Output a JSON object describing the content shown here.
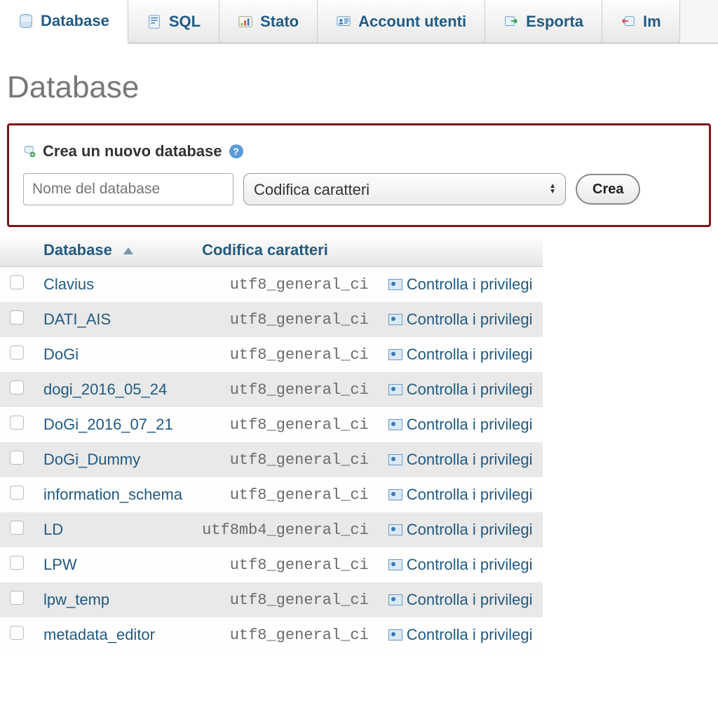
{
  "tabs": [
    {
      "label": "Database"
    },
    {
      "label": "SQL"
    },
    {
      "label": "Stato"
    },
    {
      "label": "Account utenti"
    },
    {
      "label": "Esporta"
    },
    {
      "label": "Im"
    }
  ],
  "page_title": "Database",
  "create": {
    "heading": "Crea un nuovo database",
    "name_placeholder": "Nome del database",
    "collation_placeholder": "Codifica caratteri",
    "button": "Crea"
  },
  "columns": {
    "database": "Database",
    "collation": "Codifica caratteri"
  },
  "priv_label": "Controlla i privilegi",
  "databases": [
    {
      "name": "Clavius",
      "collation": "utf8_general_ci"
    },
    {
      "name": "DATI_AIS",
      "collation": "utf8_general_ci"
    },
    {
      "name": "DoGi",
      "collation": "utf8_general_ci"
    },
    {
      "name": "dogi_2016_05_24",
      "collation": "utf8_general_ci"
    },
    {
      "name": "DoGi_2016_07_21",
      "collation": "utf8_general_ci"
    },
    {
      "name": "DoGi_Dummy",
      "collation": "utf8_general_ci"
    },
    {
      "name": "information_schema",
      "collation": "utf8_general_ci"
    },
    {
      "name": "LD",
      "collation": "utf8mb4_general_ci"
    },
    {
      "name": "LPW",
      "collation": "utf8_general_ci"
    },
    {
      "name": "lpw_temp",
      "collation": "utf8_general_ci"
    },
    {
      "name": "metadata_editor",
      "collation": "utf8_general_ci"
    }
  ]
}
